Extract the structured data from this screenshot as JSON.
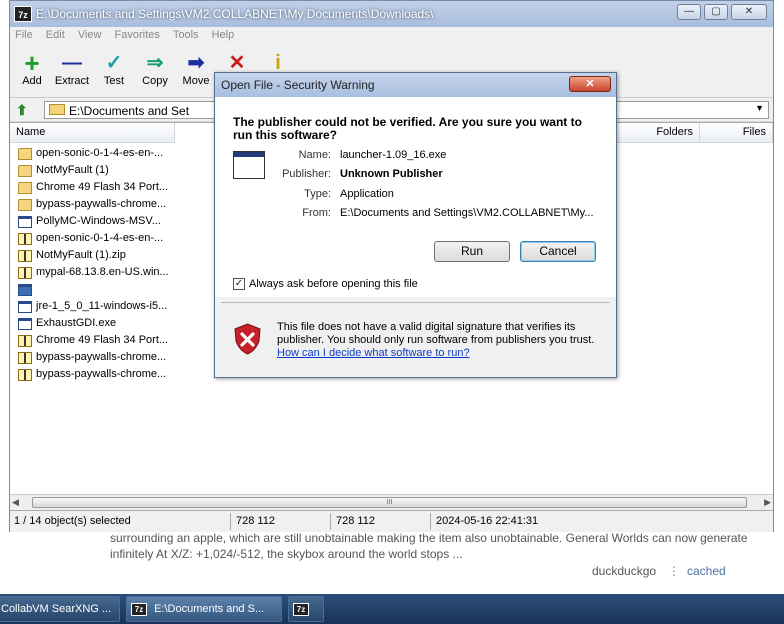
{
  "background": {
    "snippet": "surrounding an apple, which are still unobtainable making the item also unobtainable. General Worlds can now generate infinitely At X/Z: +1,024/-512, the skybox around the world stops ...",
    "source": "duckduckgo",
    "separator": "⋮",
    "cached": "cached"
  },
  "window": {
    "title": "E:\\Documents and Settings\\VM2.COLLABNET\\My Documents\\Downloads\\",
    "app_icon": "7z",
    "controls": {
      "minimize": "—",
      "maximize": "▢",
      "close": "✕"
    }
  },
  "menu": [
    "File",
    "Edit",
    "View",
    "Favorites",
    "Tools",
    "Help"
  ],
  "toolbar": {
    "add": {
      "label": "Add",
      "icon": "+",
      "color": "#1f9a2a"
    },
    "extract": {
      "label": "Extract",
      "icon": "—",
      "color": "#1d2f9e"
    },
    "test": {
      "label": "Test",
      "icon": "✓",
      "color": "#1aa0a8"
    },
    "copy": {
      "label": "Copy",
      "icon": "⇒",
      "color": "#1a9c70"
    },
    "move": {
      "label": "Move",
      "icon": "➡",
      "color": "#1d2f9e"
    },
    "delete": {
      "label": "Delete",
      "icon": "✕",
      "color": "#d01818"
    },
    "info": {
      "label": "Info",
      "icon": "i",
      "color": "#c8a800"
    }
  },
  "address": {
    "up_icon": "⬆",
    "value": "E:\\Documents and Settings\\V",
    "dropdown": "▼"
  },
  "columns": {
    "name": "Name",
    "folders": "Folders",
    "files": "Files"
  },
  "files": [
    {
      "name": "open-sonic-0-1-4-es-en-...",
      "type": "folder"
    },
    {
      "name": "NotMyFault (1)",
      "type": "folder"
    },
    {
      "name": "Chrome 49 Flash 34 Port...",
      "type": "folder"
    },
    {
      "name": "bypass-paywalls-chrome...",
      "type": "folder"
    },
    {
      "name": "PollyMC-Windows-MSV...",
      "type": "exe"
    },
    {
      "name": "open-sonic-0-1-4-es-en-...",
      "type": "zip"
    },
    {
      "name": "NotMyFault (1).zip",
      "type": "zip"
    },
    {
      "name": "mypal-68.13.8.en-US.win...",
      "type": "zip"
    },
    {
      "name": "",
      "type": "selected"
    },
    {
      "name": "jre-1_5_0_11-windows-i5...",
      "type": "exe"
    },
    {
      "name": "ExhaustGDI.exe",
      "type": "exe"
    },
    {
      "name": "Chrome 49 Flash 34 Port...",
      "type": "zip"
    },
    {
      "name": "bypass-paywalls-chrome...",
      "type": "zip"
    },
    {
      "name": "bypass-paywalls-chrome...",
      "type": "zip"
    }
  ],
  "scroll": {
    "left": "◀",
    "right": "▶",
    "grip": "III"
  },
  "status": {
    "selected": "1 / 14 object(s) selected",
    "size": "728 112",
    "packed": "728 112",
    "modified": "2024-05-16 22:41:31"
  },
  "dialog": {
    "title": "Open File - Security Warning",
    "close": "✕",
    "heading": "The publisher could not be verified.  Are you sure you want to run this software?",
    "labels": {
      "name": "Name:",
      "publisher": "Publisher:",
      "type": "Type:",
      "from": "From:"
    },
    "values": {
      "name": "launcher-1.09_16.exe",
      "publisher": "Unknown Publisher",
      "type": "Application",
      "from": "E:\\Documents and Settings\\VM2.COLLABNET\\My..."
    },
    "run": "Run",
    "cancel": "Cancel",
    "checkbox_label": "Always ask before opening this file",
    "checkbox_mark": "✓",
    "warning": "This file does not have a valid digital signature that verifies its publisher.  You should only run software from publishers you trust.",
    "link": "How can I decide what software to run?"
  },
  "taskbar": [
    {
      "label": "CollabVM SearXNG ...",
      "icon": ""
    },
    {
      "label": "E:\\Documents and S...",
      "icon": "7z"
    },
    {
      "label": "",
      "icon": "7z"
    }
  ]
}
